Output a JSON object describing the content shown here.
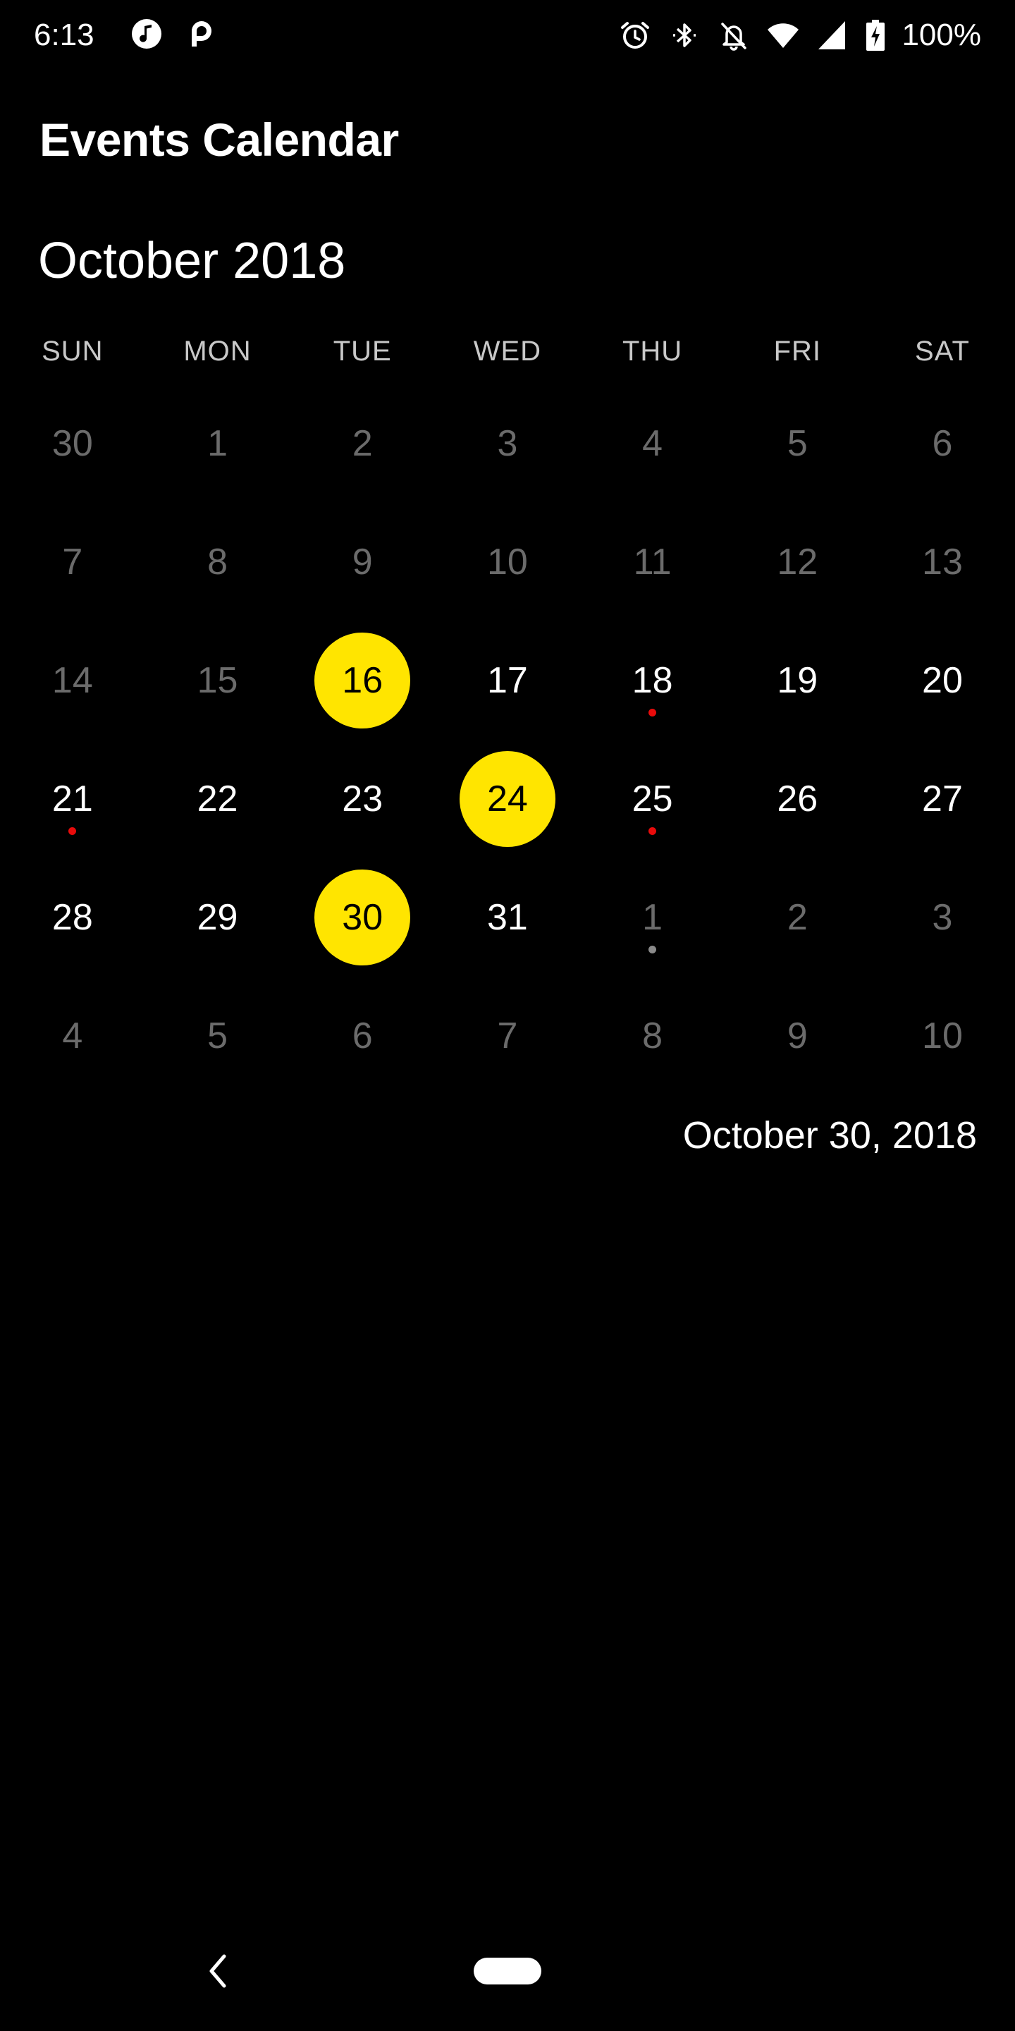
{
  "status_bar": {
    "time": "6:13",
    "battery_percent": "100%",
    "left_icons": [
      "music-note-icon",
      "pocket-casts-icon"
    ],
    "right_icons": [
      "alarm-icon",
      "bluetooth-icon",
      "notifications-off-icon",
      "wifi-icon",
      "cell-signal-icon",
      "battery-charging-icon"
    ]
  },
  "header": {
    "app_title": "Events Calendar"
  },
  "calendar": {
    "month_label": "October 2018",
    "weekdays": [
      "SUN",
      "MON",
      "TUE",
      "WED",
      "THU",
      "FRI",
      "SAT"
    ],
    "days": [
      {
        "num": "30",
        "state": "other"
      },
      {
        "num": "1",
        "state": "muted"
      },
      {
        "num": "2",
        "state": "muted"
      },
      {
        "num": "3",
        "state": "muted"
      },
      {
        "num": "4",
        "state": "muted"
      },
      {
        "num": "5",
        "state": "muted"
      },
      {
        "num": "6",
        "state": "muted"
      },
      {
        "num": "7",
        "state": "muted"
      },
      {
        "num": "8",
        "state": "muted"
      },
      {
        "num": "9",
        "state": "muted"
      },
      {
        "num": "10",
        "state": "muted"
      },
      {
        "num": "11",
        "state": "muted"
      },
      {
        "num": "12",
        "state": "muted"
      },
      {
        "num": "13",
        "state": "muted"
      },
      {
        "num": "14",
        "state": "muted"
      },
      {
        "num": "15",
        "state": "muted"
      },
      {
        "num": "16",
        "state": "selected"
      },
      {
        "num": "17",
        "state": "normal"
      },
      {
        "num": "18",
        "state": "normal",
        "dot": "red"
      },
      {
        "num": "19",
        "state": "normal"
      },
      {
        "num": "20",
        "state": "normal"
      },
      {
        "num": "21",
        "state": "normal",
        "dot": "red"
      },
      {
        "num": "22",
        "state": "normal"
      },
      {
        "num": "23",
        "state": "normal"
      },
      {
        "num": "24",
        "state": "selected"
      },
      {
        "num": "25",
        "state": "normal",
        "dot": "red"
      },
      {
        "num": "26",
        "state": "normal"
      },
      {
        "num": "27",
        "state": "normal"
      },
      {
        "num": "28",
        "state": "normal"
      },
      {
        "num": "29",
        "state": "normal"
      },
      {
        "num": "30",
        "state": "selected"
      },
      {
        "num": "31",
        "state": "normal"
      },
      {
        "num": "1",
        "state": "other",
        "dot": "grey"
      },
      {
        "num": "2",
        "state": "other"
      },
      {
        "num": "3",
        "state": "other"
      },
      {
        "num": "4",
        "state": "other"
      },
      {
        "num": "5",
        "state": "other"
      },
      {
        "num": "6",
        "state": "other"
      },
      {
        "num": "7",
        "state": "other"
      },
      {
        "num": "8",
        "state": "other"
      },
      {
        "num": "9",
        "state": "other"
      },
      {
        "num": "10",
        "state": "other"
      }
    ],
    "selected_date_label": "October 30, 2018"
  },
  "colors": {
    "background": "#000000",
    "highlight": "#ffe500",
    "event_dot": "#e80b0b",
    "muted_text": "#6b6b6b"
  }
}
